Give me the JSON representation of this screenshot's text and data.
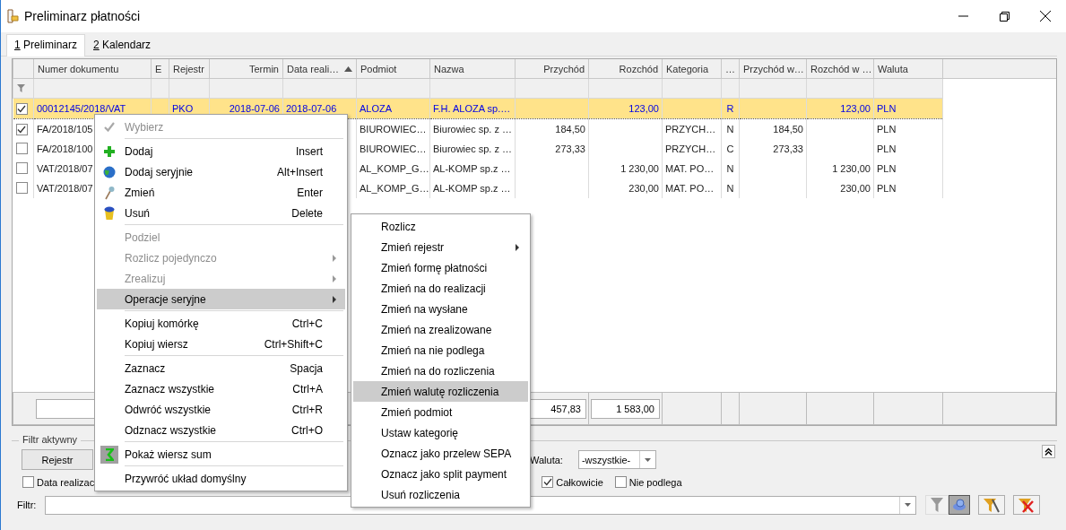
{
  "window": {
    "title": "Preliminarz płatności"
  },
  "tabs": [
    {
      "label": "1 Preliminarz",
      "selected": true
    },
    {
      "label": "2 Kalendarz",
      "selected": false
    }
  ],
  "table": {
    "columns": [
      {
        "label": "Numer dokumentu",
        "sorted": false
      },
      {
        "label": "E",
        "sorted": false
      },
      {
        "label": "Rejestr",
        "sorted": false
      },
      {
        "label": "Termin",
        "sorted": false
      },
      {
        "label": "Data reali…",
        "sorted": true
      },
      {
        "label": "Podmiot",
        "sorted": false
      },
      {
        "label": "Nazwa",
        "sorted": false
      },
      {
        "label": "Przychód",
        "sorted": false,
        "total": "457,83"
      },
      {
        "label": "Rozchód",
        "sorted": false,
        "total": "1 583,00"
      },
      {
        "label": "Kategoria",
        "sorted": false
      },
      {
        "label": "…",
        "sorted": false
      },
      {
        "label": "Przychód w…",
        "sorted": false
      },
      {
        "label": "Rozchód w …",
        "sorted": false
      },
      {
        "label": "Waluta",
        "sorted": false
      }
    ],
    "rows": [
      {
        "checked": true,
        "selected": true,
        "cells": [
          "00012145/2018/VAT",
          null,
          "PKO",
          "2018-07-06",
          "2018-07-06",
          "ALOZA",
          "F.H. ALOZA sp.…",
          null,
          "123,00",
          null,
          "R",
          null,
          "123,00",
          "PLN"
        ]
      },
      {
        "checked": true,
        "selected": false,
        "cells": [
          "FA/2018/105",
          null,
          null,
          null,
          null,
          "BIUROWIEC…",
          "Biurowiec sp. z …",
          "184,50",
          null,
          "PRZYCH…",
          "N",
          "184,50",
          null,
          "PLN"
        ]
      },
      {
        "checked": false,
        "selected": false,
        "cells": [
          "FA/2018/100",
          null,
          null,
          null,
          null,
          "BIUROWIEC…",
          "Biurowiec sp. z …",
          "273,33",
          null,
          "PRZYCH…",
          "C",
          "273,33",
          null,
          "PLN"
        ]
      },
      {
        "checked": false,
        "selected": false,
        "cells": [
          "VAT/2018/07",
          null,
          null,
          null,
          null,
          "AL_KOMP_G…",
          "AL-KOMP sp.z …",
          null,
          "1 230,00",
          "MAT. PO…",
          "N",
          null,
          "1 230,00",
          "PLN"
        ]
      },
      {
        "checked": false,
        "selected": false,
        "cells": [
          "VAT/2018/07",
          null,
          null,
          null,
          null,
          "AL_KOMP_G…",
          "AL-KOMP sp.z …",
          null,
          "230,00",
          "MAT. PO…",
          "N",
          null,
          "230,00",
          "PLN"
        ]
      }
    ]
  },
  "filter": {
    "title": "Filtr aktywny",
    "register_button": "Rejestr",
    "date_checkbox": {
      "label": "Data realizac",
      "checked": false
    },
    "currency": {
      "label": "Waluta:",
      "value": "-wszystkie-"
    },
    "complete_checkbox": {
      "label": "Całkowicie",
      "checked": true
    },
    "exempt_checkbox": {
      "label": "Nie podlega",
      "checked": false
    },
    "filter_label": "Filtr:"
  },
  "context_menu": {
    "items": [
      {
        "kind": "item",
        "label": "Wybierz",
        "disabled": true,
        "selected": false,
        "has_submenu": false
      },
      {
        "kind": "separator"
      },
      {
        "kind": "item",
        "label": "Dodaj",
        "shortcut": "Insert",
        "disabled": false,
        "selected": false,
        "has_submenu": false
      },
      {
        "kind": "item",
        "label": "Dodaj seryjnie",
        "shortcut": "Alt+Insert",
        "disabled": false,
        "selected": false,
        "has_submenu": false
      },
      {
        "kind": "item",
        "label": "Zmień",
        "shortcut": "Enter",
        "disabled": false,
        "selected": false,
        "has_submenu": false
      },
      {
        "kind": "item",
        "label": "Usuń",
        "shortcut": "Delete",
        "disabled": false,
        "selected": false,
        "has_submenu": false
      },
      {
        "kind": "separator"
      },
      {
        "kind": "item",
        "label": "Podziel",
        "disabled": true,
        "selected": false,
        "has_submenu": false
      },
      {
        "kind": "item",
        "label": "Rozlicz pojedynczo",
        "disabled": true,
        "selected": false,
        "has_submenu": true
      },
      {
        "kind": "item",
        "label": "Zrealizuj",
        "disabled": true,
        "selected": false,
        "has_submenu": true
      },
      {
        "kind": "item",
        "label": "Operacje seryjne",
        "disabled": false,
        "selected": true,
        "has_submenu": true
      },
      {
        "kind": "separator"
      },
      {
        "kind": "item",
        "label": "Kopiuj komórkę",
        "shortcut": "Ctrl+C",
        "disabled": false,
        "selected": false,
        "has_submenu": false
      },
      {
        "kind": "item",
        "label": "Kopiuj wiersz",
        "shortcut": "Ctrl+Shift+C",
        "disabled": false,
        "selected": false,
        "has_submenu": false
      },
      {
        "kind": "separator"
      },
      {
        "kind": "item",
        "label": "Zaznacz",
        "shortcut": "Spacja",
        "disabled": false,
        "selected": false,
        "has_submenu": false
      },
      {
        "kind": "item",
        "label": "Zaznacz wszystkie",
        "shortcut": "Ctrl+A",
        "disabled": false,
        "selected": false,
        "has_submenu": false
      },
      {
        "kind": "item",
        "label": "Odwróć wszystkie",
        "shortcut": "Ctrl+R",
        "disabled": false,
        "selected": false,
        "has_submenu": false
      },
      {
        "kind": "item",
        "label": "Odznacz wszystkie",
        "shortcut": "Ctrl+O",
        "disabled": false,
        "selected": false,
        "has_submenu": false
      },
      {
        "kind": "separator"
      },
      {
        "kind": "item",
        "label": "Pokaż wiersz sum",
        "disabled": false,
        "selected": false,
        "has_submenu": false
      },
      {
        "kind": "separator"
      },
      {
        "kind": "item",
        "label": "Przywróć układ domyślny",
        "disabled": false,
        "selected": false,
        "has_submenu": false
      }
    ]
  },
  "submenu": {
    "items": [
      {
        "kind": "item",
        "label": "Rozlicz",
        "disabled": false,
        "selected": false,
        "has_submenu": false
      },
      {
        "kind": "item",
        "label": "Zmień rejestr",
        "disabled": false,
        "selected": false,
        "has_submenu": true
      },
      {
        "kind": "item",
        "label": "Zmień formę płatności",
        "disabled": false,
        "selected": false,
        "has_submenu": false
      },
      {
        "kind": "item",
        "label": "Zmień na do realizacji",
        "disabled": false,
        "selected": false,
        "has_submenu": false
      },
      {
        "kind": "item",
        "label": "Zmień na wysłane",
        "disabled": false,
        "selected": false,
        "has_submenu": false
      },
      {
        "kind": "item",
        "label": "Zmień na zrealizowane",
        "disabled": false,
        "selected": false,
        "has_submenu": false
      },
      {
        "kind": "item",
        "label": "Zmień na nie podlega",
        "disabled": false,
        "selected": false,
        "has_submenu": false
      },
      {
        "kind": "item",
        "label": "Zmień na do rozliczenia",
        "disabled": false,
        "selected": false,
        "has_submenu": false
      },
      {
        "kind": "item",
        "label": "Zmień walutę rozliczenia",
        "disabled": false,
        "selected": true,
        "has_submenu": false
      },
      {
        "kind": "item",
        "label": "Zmień podmiot",
        "disabled": false,
        "selected": false,
        "has_submenu": false
      },
      {
        "kind": "item",
        "label": "Ustaw kategorię",
        "disabled": false,
        "selected": false,
        "has_submenu": false
      },
      {
        "kind": "item",
        "label": "Oznacz jako przelew SEPA",
        "disabled": false,
        "selected": false,
        "has_submenu": false
      },
      {
        "kind": "item",
        "label": "Oznacz jako split payment",
        "disabled": false,
        "selected": false,
        "has_submenu": false
      },
      {
        "kind": "item",
        "label": "Usuń rozliczenia",
        "disabled": false,
        "selected": false,
        "has_submenu": false
      }
    ]
  }
}
